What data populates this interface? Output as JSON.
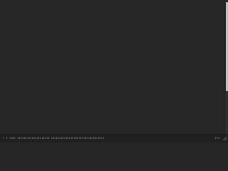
{
  "status": {
    "left_text": "T T Tabl  IIIIIIIIIIIIIIIIIIII  IIIIIIIIIIIIIIIIIIIIIIIIIIIIIIIII",
    "right_text": "III"
  },
  "colors": {
    "background": "#272727",
    "statusbar": "#202020",
    "scroll_thumb": "#bdbdbd",
    "text": "#9a9a9a"
  }
}
